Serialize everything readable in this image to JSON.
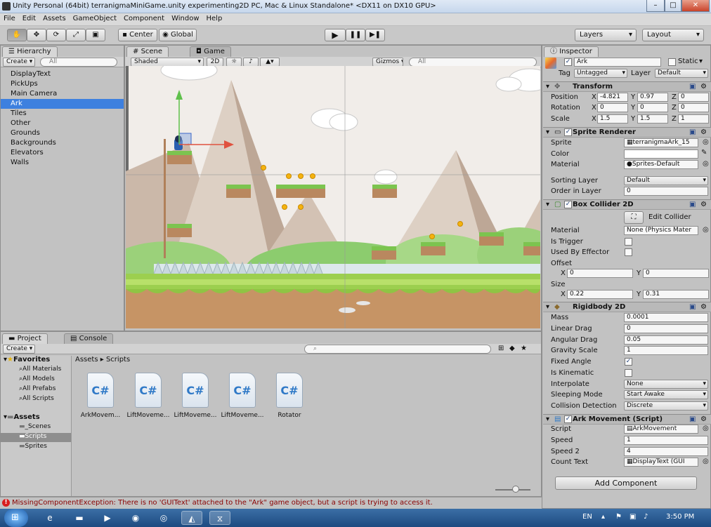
{
  "window": {
    "title": "Unity Personal (64bit)   terranigmaMiniGame.unity   experimenting2D   PC, Mac & Linux Standalone* <DX11 on DX10 GPU>",
    "minimize": "–",
    "maximize": "□",
    "close": "✕"
  },
  "menu": [
    "File",
    "Edit",
    "Assets",
    "GameObject",
    "Component",
    "Window",
    "Help"
  ],
  "toolbar": {
    "pivot": "Center",
    "space": "Global",
    "layers": "Layers",
    "layout": "Layout"
  },
  "hierarchy": {
    "tab": "Hierarchy",
    "create": "Create",
    "search_placeholder": "All",
    "items": [
      "DisplayText",
      "PickUps",
      "Main Camera",
      "Ark",
      "Tiles",
      "Other",
      "Grounds",
      "Backgrounds",
      "Elevators",
      "Walls"
    ],
    "selected": "Ark"
  },
  "scene": {
    "tab_scene": "Scene",
    "tab_game": "Game",
    "shading": "Shaded",
    "mode_2d": "2D",
    "gizmos": "Gizmos",
    "search_placeholder": "All"
  },
  "project": {
    "tab_project": "Project",
    "tab_console": "Console",
    "create": "Create",
    "favorites_label": "Favorites",
    "favorites": [
      "All Materials",
      "All Models",
      "All Prefabs",
      "All Scripts"
    ],
    "assets_label": "Assets",
    "assets": [
      "_Scenes",
      "Scripts",
      "Sprites"
    ],
    "selected_folder": "Scripts",
    "breadcrumb": [
      "Assets",
      "Scripts"
    ],
    "files": [
      "ArkMovem...",
      "LiftMoveme...",
      "LiftMoveme...",
      "LiftMoveme...",
      "Rotator"
    ],
    "file_glyph": "C#"
  },
  "status_error": "MissingComponentException: There is no 'GUIText' attached to the \"Ark\" game object, but a script is trying to access it.",
  "inspector": {
    "tab": "Inspector",
    "object_name": "Ark",
    "static_label": "Static",
    "tag_label": "Tag",
    "tag_value": "Untagged",
    "layer_label": "Layer",
    "layer_value": "Default",
    "transform": {
      "title": "Transform",
      "position_label": "Position",
      "position": [
        "-4.821",
        "0.97",
        "0"
      ],
      "rotation_label": "Rotation",
      "rotation": [
        "0",
        "0",
        "0"
      ],
      "scale_label": "Scale",
      "scale": [
        "1.5",
        "1.5",
        "1"
      ],
      "axes": [
        "X",
        "Y",
        "Z"
      ]
    },
    "sprite_renderer": {
      "title": "Sprite Renderer",
      "sprite_label": "Sprite",
      "sprite": "terranigmaArk_15",
      "color_label": "Color",
      "material_label": "Material",
      "material": "Sprites-Default",
      "sorting_layer_label": "Sorting Layer",
      "sorting_layer": "Default",
      "order_label": "Order in Layer",
      "order": "0"
    },
    "box_collider": {
      "title": "Box Collider 2D",
      "edit_collider": "Edit Collider",
      "material_label": "Material",
      "material": "None (Physics Mater",
      "is_trigger_label": "Is Trigger",
      "used_by_effector_label": "Used By Effector",
      "offset_label": "Offset",
      "offset": [
        "0",
        "0"
      ],
      "size_label": "Size",
      "size": [
        "0.22",
        "0.31"
      ]
    },
    "rigidbody": {
      "title": "Rigidbody 2D",
      "mass_label": "Mass",
      "mass": "0.0001",
      "linear_drag_label": "Linear Drag",
      "linear_drag": "0",
      "angular_drag_label": "Angular Drag",
      "angular_drag": "0.05",
      "gravity_label": "Gravity Scale",
      "gravity": "1",
      "fixed_angle_label": "Fixed Angle",
      "kinematic_label": "Is Kinematic",
      "interpolate_label": "Interpolate",
      "interpolate": "None",
      "sleeping_label": "Sleeping Mode",
      "sleeping": "Start Awake",
      "collision_label": "Collision Detection",
      "collision": "Discrete"
    },
    "ark_movement": {
      "title": "Ark Movement (Script)",
      "script_label": "Script",
      "script": "ArkMovement",
      "speed_label": "Speed",
      "speed": "1",
      "speed2_label": "Speed 2",
      "speed2": "4",
      "count_text_label": "Count Text",
      "count_text": "DisplayText (GUI"
    },
    "add_component": "Add Component"
  },
  "taskbar": {
    "lang": "EN",
    "time": "3:50 PM"
  }
}
